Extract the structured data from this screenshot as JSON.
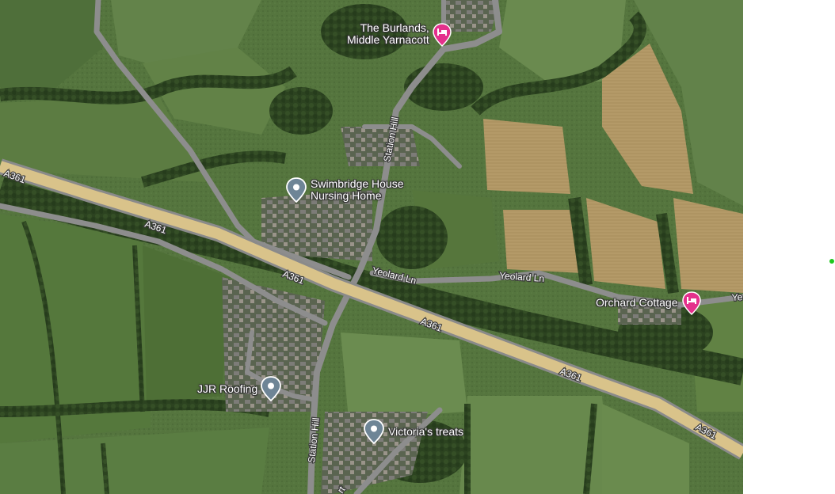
{
  "map": {
    "view": "satellite",
    "roads": {
      "a361_labels": [
        "A361",
        "A361",
        "A361",
        "A361",
        "A361",
        "A361"
      ],
      "station_hill_labels": [
        "Station Hill",
        "Station Hill"
      ],
      "yeolard_labels": [
        "Yeolard Ln",
        "Yeolard Ln",
        "Ye"
      ],
      "partial_label": "rt"
    },
    "places": [
      {
        "name_line1": "The Burlands,",
        "name_line2": "Middle Yarnacott",
        "icon": "hotel-icon",
        "color": "#e4308c"
      },
      {
        "name_line1": "Swimbridge House",
        "name_line2": "Nursing Home",
        "icon": "place-pin-icon",
        "color": "#6e8596"
      },
      {
        "name": "Orchard Cottage",
        "icon": "hotel-icon",
        "color": "#e4308c"
      },
      {
        "name": "JJR Roofing",
        "icon": "place-pin-icon",
        "color": "#6e8596"
      },
      {
        "name": "Victoria's treats",
        "icon": "place-pin-icon",
        "color": "#6e8596"
      }
    ],
    "colors": {
      "a_road": "#d9c38a",
      "minor_road": "#8c8c8c",
      "field_dark": "#3f5e2e",
      "field_light": "#5f7f45",
      "crop": "#b89e6c"
    }
  }
}
